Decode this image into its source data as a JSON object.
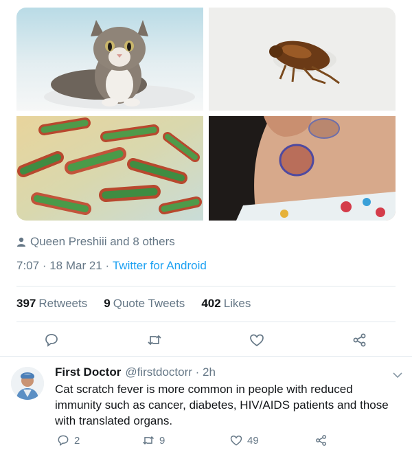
{
  "tweet": {
    "media": [
      {
        "alt_icon": "cat-photo"
      },
      {
        "alt_icon": "flea-photo"
      },
      {
        "alt_icon": "bacteria-illustration"
      },
      {
        "alt_icon": "neck-lesion-photo"
      }
    ],
    "tagged_text": "Queen Preshiii and 8 others",
    "time": "7:07",
    "date": "18 Mar 21",
    "source": "Twitter for Android",
    "sep": " · ",
    "stats": {
      "retweets_count": "397",
      "retweets_label": "Retweets",
      "quotes_count": "9",
      "quotes_label": "Quote Tweets",
      "likes_count": "402",
      "likes_label": "Likes"
    }
  },
  "reply": {
    "name": "First Doctor",
    "handle": "@firstdoctorr · 2h",
    "text": "Cat scratch fever is more common in people with reduced immunity such as cancer, diabetes, HIV/AIDS patients and those with translated organs.",
    "reply_count": "2",
    "retweet_count": "9",
    "like_count": "49"
  },
  "colors": {
    "accent": "#1da1f2",
    "muted": "#657786",
    "divider": "#e1e8ed"
  }
}
